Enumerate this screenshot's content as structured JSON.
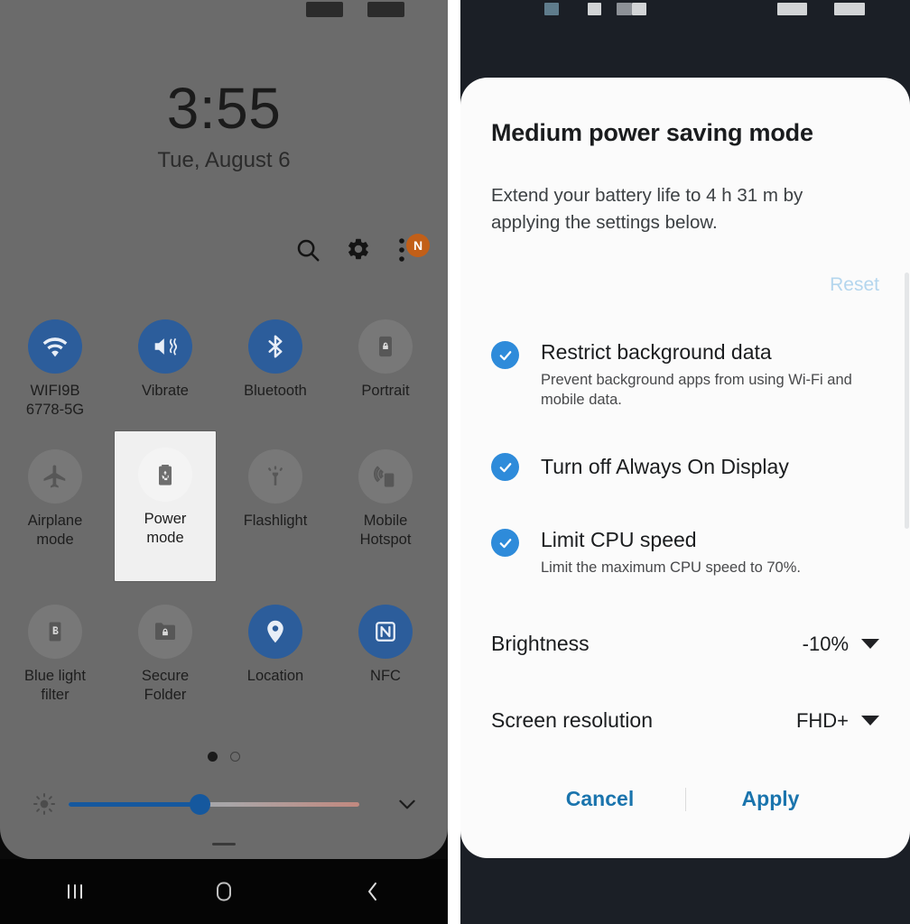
{
  "left_panel": {
    "statusbar": {
      "redacted_blocks": 2
    },
    "clock": {
      "time": "3:55",
      "date": "Tue, August 6"
    },
    "header_icons": [
      {
        "name": "search-icon",
        "label": "Search"
      },
      {
        "name": "gear-icon",
        "label": "Settings"
      },
      {
        "name": "overflow-menu-icon",
        "label": "More options",
        "badge": "N",
        "badge_color": "#c25f18"
      }
    ],
    "tiles": [
      {
        "label": "WIFI9B\n6778-5G",
        "label_line1": "WIFI9B",
        "label_line2": "6778-5G",
        "icon": "wifi-icon",
        "state": "on"
      },
      {
        "label": "Vibrate",
        "icon": "vibrate-icon",
        "state": "on"
      },
      {
        "label": "Bluetooth",
        "icon": "bluetooth-icon",
        "state": "on"
      },
      {
        "label": "Portrait",
        "icon": "screen-rotation-lock-icon",
        "state": "off"
      },
      {
        "label": "Airplane\nmode",
        "label_line1": "Airplane",
        "label_line2": "mode",
        "icon": "airplane-icon",
        "state": "off"
      },
      {
        "label": "Power\nmode",
        "label_line1": "Power",
        "label_line2": "mode",
        "icon": "power-saving-battery-icon",
        "state": "selected"
      },
      {
        "label": "Flashlight",
        "icon": "flashlight-icon",
        "state": "off"
      },
      {
        "label": "Mobile\nHotspot",
        "label_line1": "Mobile",
        "label_line2": "Hotspot",
        "icon": "mobile-hotspot-icon",
        "state": "off"
      },
      {
        "label": "Blue light\nfilter",
        "label_line1": "Blue light",
        "label_line2": "filter",
        "icon": "blue-light-filter-icon",
        "state": "off"
      },
      {
        "label": "Secure\nFolder",
        "label_line1": "Secure",
        "label_line2": "Folder",
        "icon": "secure-folder-icon",
        "state": "off"
      },
      {
        "label": "Location",
        "icon": "location-pin-icon",
        "state": "on"
      },
      {
        "label": "NFC",
        "icon": "nfc-icon",
        "state": "on"
      }
    ],
    "pager": {
      "pages": 2,
      "active_page": 1
    },
    "brightness": {
      "icon": "brightness-icon",
      "value_percent": 45,
      "expand_icon": "chevron-down-icon"
    },
    "colors": {
      "tile_on": "#2c5d9b",
      "sheet_bg": "#6b6b6b",
      "slider_fill": "#15589e"
    }
  },
  "right_panel": {
    "statusbar": {
      "redacted_blocks": 6
    },
    "dialog": {
      "title": "Medium power saving mode",
      "description": "Extend your battery life to 4 h 31 m by applying the settings below.",
      "reset_label": "Reset",
      "options": [
        {
          "title": "Restrict background data",
          "subtitle": "Prevent background apps from using Wi-Fi and mobile data.",
          "checked": true
        },
        {
          "title": "Turn off Always On Display",
          "subtitle": "",
          "checked": true
        },
        {
          "title": "Limit CPU speed",
          "subtitle": "Limit the maximum CPU speed to 70%.",
          "checked": true
        }
      ],
      "settings": [
        {
          "label": "Brightness",
          "value": "-10%"
        },
        {
          "label": "Screen resolution",
          "value": "FHD+"
        }
      ],
      "cancel_label": "Cancel",
      "apply_label": "Apply",
      "colors": {
        "checkbox": "#2e8bda",
        "action_text": "#1a74ad",
        "reset_text": "#b4d6ee"
      }
    }
  },
  "navbar": {
    "items": [
      {
        "name": "recents-button",
        "glyph": "|||"
      },
      {
        "name": "home-button",
        "glyph": "home"
      },
      {
        "name": "back-button",
        "glyph": "<"
      }
    ]
  }
}
